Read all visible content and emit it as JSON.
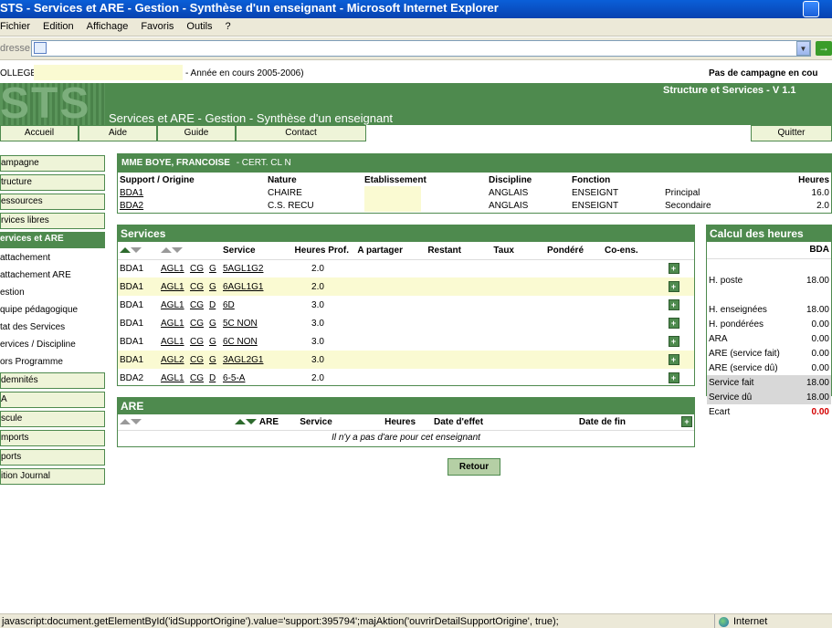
{
  "window": {
    "title": "STS - Services et ARE - Gestion - Synthèse d'un enseignant - Microsoft Internet Explorer"
  },
  "menu": [
    "Fichier",
    "Edition",
    "Affichage",
    "Favoris",
    "Outils",
    "?"
  ],
  "address": {
    "label": "dresse"
  },
  "topinfo": {
    "college_label": "OLLEGE",
    "year_text": "- Année en cours 2005-2006)",
    "campaign_text": "Pas de campagne en cou"
  },
  "banner": {
    "logo": "STS",
    "app_name": "Structure et Services - V 1.1",
    "page_title": "Services et ARE - Gestion - Synthèse d'un enseignant"
  },
  "nav": {
    "accueil": "Accueil",
    "aide": "Aide",
    "guide": "Guide",
    "contact": "Contact",
    "quitter": "Quitter"
  },
  "sidebar": [
    {
      "label": "ampagne",
      "style": "box"
    },
    {
      "label": "tructure",
      "style": "box"
    },
    {
      "label": "essources",
      "style": "box"
    },
    {
      "label": "rvices libres",
      "style": "box"
    },
    {
      "label": "ervices et ARE",
      "style": "active"
    },
    {
      "label": "attachement",
      "style": "plain"
    },
    {
      "label": "attachement ARE",
      "style": "plain"
    },
    {
      "label": "estion",
      "style": "plain"
    },
    {
      "label": "quipe pédagogique",
      "style": "plain"
    },
    {
      "label": "tat des Services",
      "style": "plain"
    },
    {
      "label": "ervices / Discipline",
      "style": "plain"
    },
    {
      "label": "ors Programme",
      "style": "plain"
    },
    {
      "label": "demnités",
      "style": "box"
    },
    {
      "label": "A",
      "style": "box"
    },
    {
      "label": "scule",
      "style": "box"
    },
    {
      "label": "mports",
      "style": "box"
    },
    {
      "label": "ports",
      "style": "box"
    },
    {
      "label": "ition Journal",
      "style": "box"
    }
  ],
  "teacher": {
    "name": "MME BOYE, FRANCOISE",
    "grade": "- CERT. CL N",
    "headers": [
      "Support / Origine",
      "Nature",
      "Etablissement",
      "Discipline",
      "Fonction",
      "",
      "Heures"
    ],
    "rows": [
      {
        "support": "BDA1",
        "nature": "CHAIRE",
        "discipline": "ANGLAIS",
        "fonction": "ENSEIGNT",
        "type": "Principal",
        "heures": "16.0"
      },
      {
        "support": "BDA2",
        "nature": "C.S. RECU",
        "discipline": "ANGLAIS",
        "fonction": "ENSEIGNT",
        "type": "Secondaire",
        "heures": "2.0"
      }
    ]
  },
  "services": {
    "title": "Services",
    "headers": {
      "service": "Service",
      "heures_prof": "Heures Prof.",
      "a_partager": "A partager",
      "restant": "Restant",
      "taux": "Taux",
      "pondere": "Pondéré",
      "coens": "Co-ens."
    },
    "rows": [
      {
        "support": "BDA1",
        "matiere": "AGL1",
        "mod": "CG",
        "type": "G",
        "division": "5AGL1G2",
        "heures": "2.0",
        "highlight": false
      },
      {
        "support": "BDA1",
        "matiere": "AGL1",
        "mod": "CG",
        "type": "G",
        "division": "6AGL1G1",
        "heures": "2.0",
        "highlight": true
      },
      {
        "support": "BDA1",
        "matiere": "AGL1",
        "mod": "CG",
        "type": "D",
        "division": "6D",
        "heures": "3.0",
        "highlight": false
      },
      {
        "support": "BDA1",
        "matiere": "AGL1",
        "mod": "CG",
        "type": "G",
        "division": "5C NON",
        "heures": "3.0",
        "highlight": false
      },
      {
        "support": "BDA1",
        "matiere": "AGL1",
        "mod": "CG",
        "type": "G",
        "division": "6C NON",
        "heures": "3.0",
        "highlight": false
      },
      {
        "support": "BDA1",
        "matiere": "AGL2",
        "mod": "CG",
        "type": "G",
        "division": "3AGL2G1",
        "heures": "3.0",
        "highlight": true
      },
      {
        "support": "BDA2",
        "matiere": "AGL1",
        "mod": "CG",
        "type": "D",
        "division": "6-5-A",
        "heures": "2.0",
        "highlight": false
      }
    ]
  },
  "are": {
    "title": "ARE",
    "headers": {
      "are": "ARE",
      "service": "Service",
      "heures": "Heures",
      "date_effet": "Date d'effet",
      "date_fin": "Date de fin"
    },
    "empty": "Il n'y a pas d'are pour cet enseignant"
  },
  "calc": {
    "title": "Calcul des heures",
    "column": "BDA",
    "rows": [
      {
        "label": "H. poste",
        "value": "18.00",
        "shade": false
      },
      {
        "label": "H. enseignées",
        "value": "18.00",
        "shade": false
      },
      {
        "label": "H. pondérées",
        "value": "0.00",
        "shade": false
      },
      {
        "label": "ARA",
        "value": "0.00",
        "shade": false
      },
      {
        "label": "ARE (service fait)",
        "value": "0.00",
        "shade": false
      },
      {
        "label": "ARE (service dû)",
        "value": "0.00",
        "shade": false
      },
      {
        "label": "Service fait",
        "value": "18.00",
        "shade": true
      },
      {
        "label": "Service dû",
        "value": "18.00",
        "shade": true
      }
    ],
    "ecart_label": "Ecart",
    "ecart_value": "0.00",
    "ecart_color": "#d40000"
  },
  "buttons": {
    "retour": "Retour"
  },
  "status": {
    "text": "javascript:document.getElementById('idSupportOrigine').value='support:395794';majAktion('ouvrirDetailSupportOrigine', true);",
    "zone": "Internet"
  },
  "colors": {
    "accent": "#4e8a4e",
    "highlight": "#fafad2",
    "panel_light": "#eef4d8"
  }
}
